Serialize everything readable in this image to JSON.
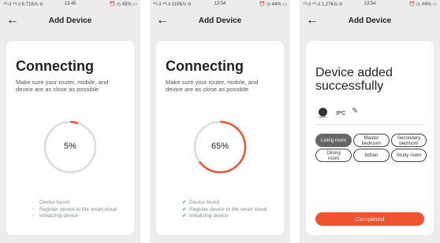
{
  "colors": {
    "accent": "#f0532f",
    "check": "#3daa55",
    "bg": "#ececec"
  },
  "screens": [
    {
      "status": {
        "left": "⁴ᴳ.ıl ⁴ᴳ.ıl 6.71K/s ≋",
        "time": "13:45",
        "right": "⏰ ◷ 45% ▭"
      },
      "header": {
        "back_icon": "arrow-left",
        "title": "Add Device"
      },
      "heading": "Connecting",
      "description": "Make sure your router, mobile, and device are as close as possible",
      "progress": {
        "value": 5,
        "label": "5%"
      },
      "steps": [
        "Device found",
        "Register device to the smart cloud",
        "Initializing device"
      ],
      "steps_done": false
    },
    {
      "status": {
        "left": "⁴ᴳ.ıl ⁴ᴳ.ıl 110K/s ≋",
        "time": "13:54",
        "right": "⏰ ◷ 44% ▭"
      },
      "header": {
        "back_icon": "arrow-left",
        "title": "Add Device"
      },
      "heading": "Connecting",
      "description": "Make sure your router, mobile, and device are as close as possible",
      "progress": {
        "value": 65,
        "label": "65%"
      },
      "steps": [
        "Device found",
        "Register device to the smart cloud",
        "Initializing device"
      ],
      "steps_done": true
    },
    {
      "status": {
        "left": "⁴ᴳ.ıl ⁴ᴳ.ıl 1.27K/s ≋",
        "time": "13:54",
        "right": "⏰ ◷ 44% ▭"
      },
      "header": {
        "back_icon": "arrow-left",
        "title": "Add Device"
      },
      "heading_line1": "Device added",
      "heading_line2": "successfully",
      "device_name": "IPC",
      "rooms": [
        {
          "line1": "Living room",
          "line2": "",
          "selected": true
        },
        {
          "line1": "Master",
          "line2": "bedroom",
          "selected": false
        },
        {
          "line1": "Secondary",
          "line2": "bedroom",
          "selected": false
        },
        {
          "line1": "Dining",
          "line2": "room",
          "selected": false
        },
        {
          "line1": "itchen",
          "line2": "",
          "selected": false
        },
        {
          "line1": "Study room",
          "line2": "",
          "selected": false
        }
      ],
      "button_label": "Completed"
    }
  ]
}
